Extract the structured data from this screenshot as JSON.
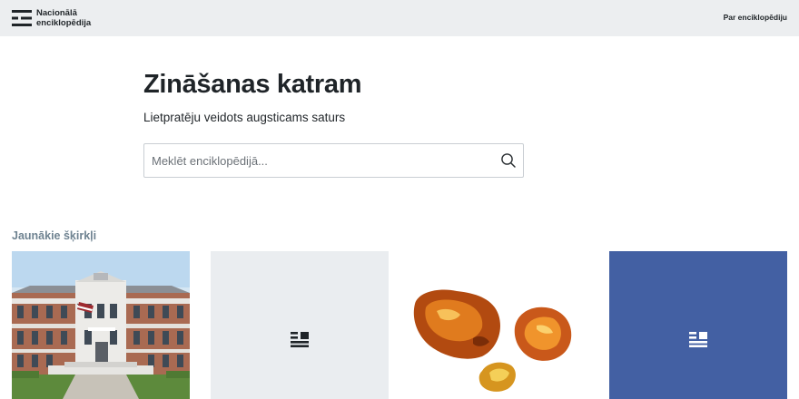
{
  "header": {
    "logo_line1": "Nacionālā",
    "logo_line2": "enciklopēdija",
    "about_link": "Par enciklopēdiju",
    "logo_icon": "encyclopedia-logo-icon"
  },
  "hero": {
    "title": "Zināšanas katram",
    "subtitle": "Lietpratēju veidots augsticams saturs"
  },
  "search": {
    "placeholder": "Meklēt enciklopēdijā...",
    "value": "",
    "icon": "search-icon"
  },
  "latest": {
    "heading": "Jaunākie šķirkļi",
    "cards": [
      {
        "kind": "photo",
        "icon": "manor-photo"
      },
      {
        "kind": "placeholder",
        "icon": "article-icon"
      },
      {
        "kind": "photo",
        "icon": "amber-photo"
      },
      {
        "kind": "placeholder",
        "icon": "article-icon"
      }
    ]
  },
  "colors": {
    "topbar_bg": "#eceef0",
    "section_heading": "#6f8391",
    "card_placeholder_light": "#eaedf0",
    "card_placeholder_blue": "#4360a3"
  }
}
